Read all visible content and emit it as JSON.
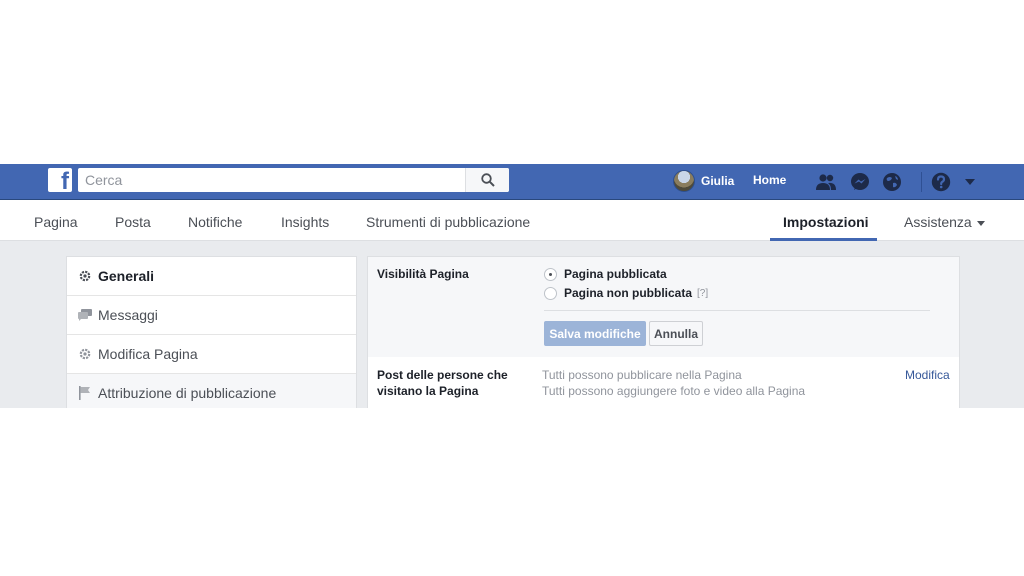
{
  "topbar": {
    "logo_letter": "f",
    "search": {
      "placeholder": "Cerca"
    },
    "user": {
      "name": "Giulia"
    },
    "home_label": "Home",
    "icons": [
      "friends-icon",
      "messenger-icon",
      "globe-notifications-icon",
      "help-icon",
      "caret-down-icon"
    ]
  },
  "page_nav": {
    "items": [
      "Pagina",
      "Posta",
      "Notifiche",
      "Insights",
      "Strumenti di pubblicazione"
    ],
    "settings_label": "Impostazioni",
    "help_label": "Assistenza"
  },
  "sidebar": {
    "items": [
      {
        "label": "Generali",
        "icon": "gear-icon",
        "selected": true
      },
      {
        "label": "Messaggi",
        "icon": "chat-icon",
        "selected": false
      },
      {
        "label": "Modifica Pagina",
        "icon": "gear-icon",
        "selected": false
      },
      {
        "label": "Attribuzione di pubblicazione",
        "icon": "flag-icon",
        "selected": false
      }
    ]
  },
  "settings": {
    "visibility": {
      "title": "Visibilità Pagina",
      "options": [
        {
          "label": "Pagina pubblicata",
          "checked": true
        },
        {
          "label": "Pagina non pubblicata",
          "checked": false
        }
      ],
      "help": "[?]",
      "save_label": "Salva modifiche",
      "cancel_label": "Annulla"
    },
    "visitor_posts": {
      "title_line1": "Post delle persone che",
      "title_line2": "visitano la Pagina",
      "line1": "Tutti possono pubblicare nella Pagina",
      "line2": "Tutti possono aggiungere foto e video alla Pagina",
      "edit_label": "Modifica"
    }
  },
  "colors": {
    "brand_blue": "#4267b2",
    "link_blue": "#365899",
    "bg_grey": "#e9ebee"
  }
}
